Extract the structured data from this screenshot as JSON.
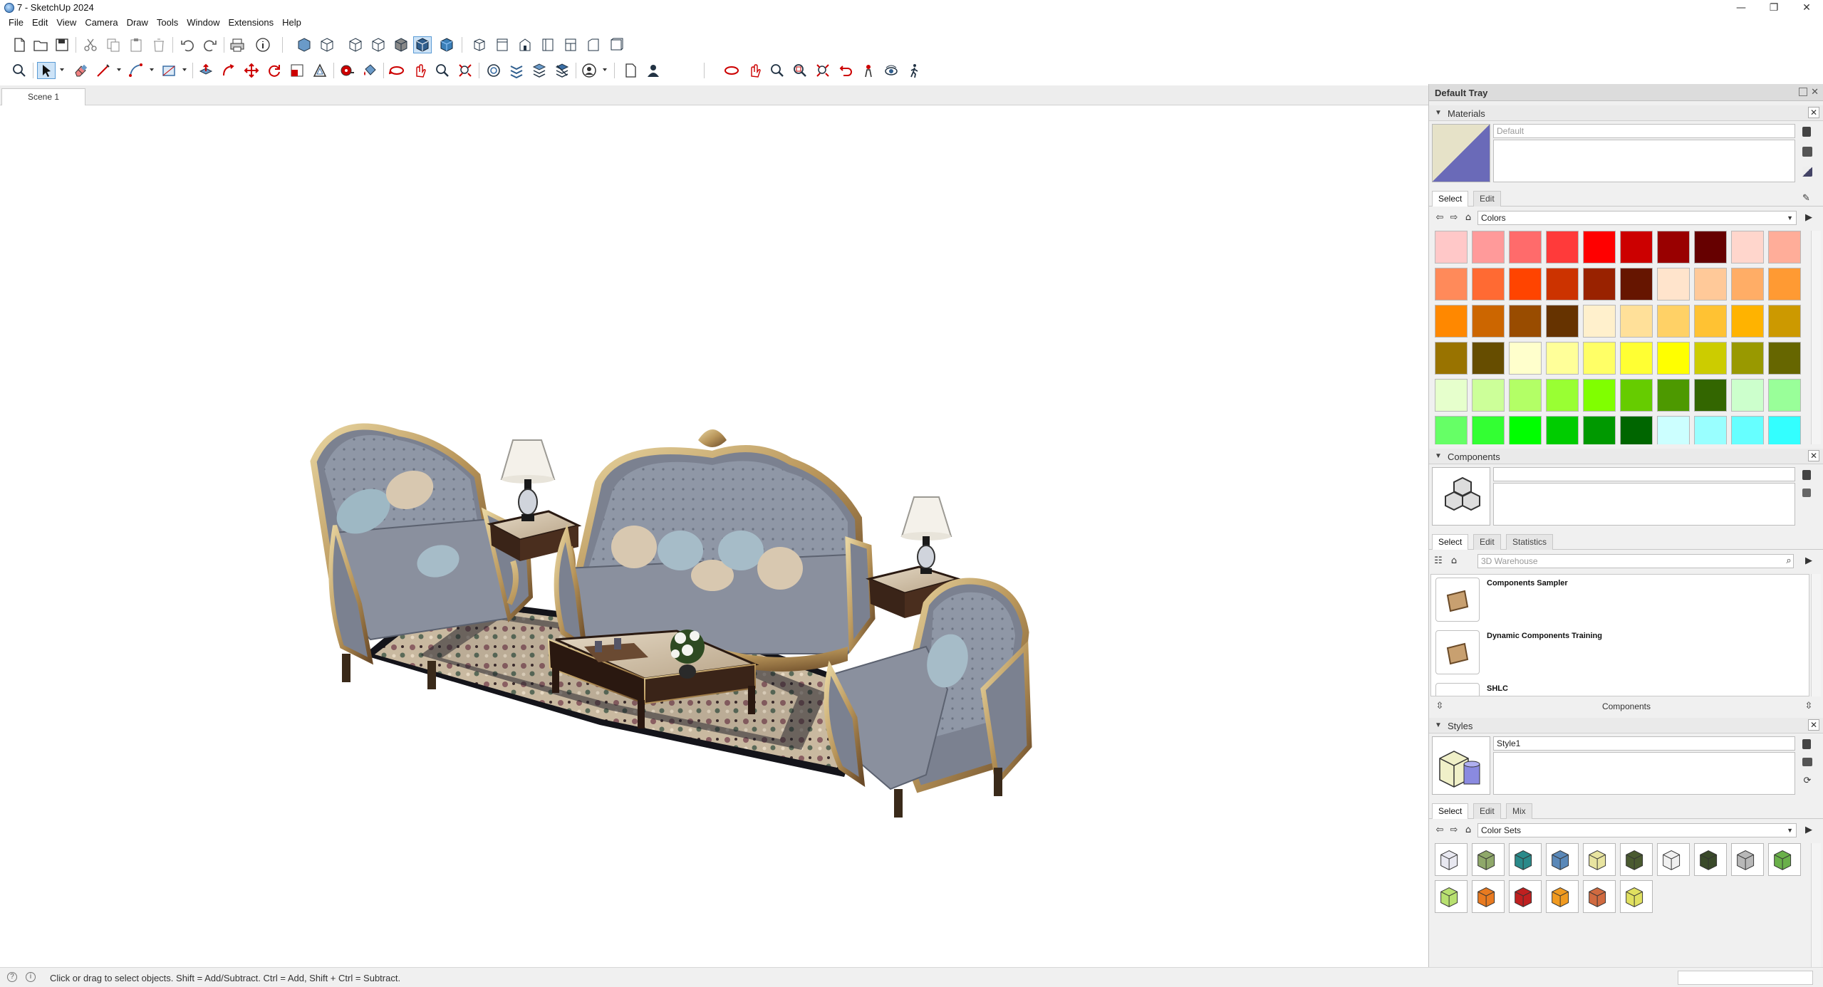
{
  "window": {
    "title": "7 - SketchUp 2024",
    "controls": [
      "—",
      "❐",
      "✕"
    ]
  },
  "menu": [
    "File",
    "Edit",
    "View",
    "Camera",
    "Draw",
    "Tools",
    "Window",
    "Extensions",
    "Help"
  ],
  "scene_tab": "Scene 1",
  "status": {
    "hint": "Click or drag to select objects. Shift = Add/Subtract. Ctrl = Add, Shift + Ctrl = Subtract.",
    "icon_a": "?",
    "icon_b": "i"
  },
  "tray": {
    "title": "Default Tray",
    "close": "✕",
    "materials": {
      "title": "Materials",
      "close": "✕",
      "name_value": "Default",
      "tabs": [
        "Select",
        "Edit"
      ],
      "library": "Colors",
      "colors": [
        "#ffc8c8",
        "#ff9a9a",
        "#ff6b6b",
        "#ff3a3a",
        "#ff0000",
        "#cc0000",
        "#990000",
        "#660000",
        "#ffd6cc",
        "#ffad99",
        "#ff8a5a",
        "#ff6a33",
        "#ff4400",
        "#cc3300",
        "#992200",
        "#661500",
        "#ffe4cc",
        "#ffc999",
        "#ffad66",
        "#ff9a33",
        "#ff8800",
        "#cc6600",
        "#994c00",
        "#663300",
        "#fff0cc",
        "#ffe099",
        "#ffd166",
        "#ffc233",
        "#ffb300",
        "#cc9900",
        "#997300",
        "#664d00",
        "#ffffcc",
        "#ffff99",
        "#ffff66",
        "#ffff33",
        "#ffff00",
        "#cccc00",
        "#999900",
        "#666600",
        "#e6ffcc",
        "#ccff99",
        "#b3ff66",
        "#99ff33",
        "#80ff00",
        "#66cc00",
        "#4d9900",
        "#336600",
        "#ccffcc",
        "#99ff99",
        "#66ff66",
        "#33ff33",
        "#00ff00",
        "#00cc00",
        "#009900",
        "#006600",
        "#ccffff",
        "#99ffff",
        "#66ffff",
        "#33ffff",
        "#00ffff",
        "#00cccc",
        "#009999",
        "#006666",
        "#ccccff",
        "#9999ff",
        "#6666ff",
        "#3333ff",
        "#0000ff",
        "#0000cc",
        "#000099",
        "#000066",
        "#e6ccff",
        "#cc99ff",
        "#b366ff",
        "#9933ff",
        "#8000ff",
        "#6600cc",
        "#4d0099",
        "#330066"
      ]
    },
    "components": {
      "title": "Components",
      "close": "✕",
      "tabs": [
        "Select",
        "Edit",
        "Statistics"
      ],
      "search_placeholder": "3D Warehouse",
      "items": [
        "Components Sampler",
        "Dynamic Components Training",
        "SHLC"
      ],
      "footer": "Components"
    },
    "styles": {
      "title": "Styles",
      "close": "✕",
      "name_value": "Style1",
      "tabs": [
        "Select",
        "Edit",
        "Mix"
      ],
      "library": "Color Sets",
      "style_colors": [
        "#e8e8f0",
        "#8fa86a",
        "#2a8a8a",
        "#5a88b8",
        "#e8e4a0",
        "#4a5a30",
        "#f0f0f0",
        "#3a4a2a",
        "#b8b8b8",
        "#6ab04a",
        "#b8e070",
        "#e87a20",
        "#c02020",
        "#f09a20",
        "#d06a40",
        "#e0e060"
      ]
    }
  }
}
